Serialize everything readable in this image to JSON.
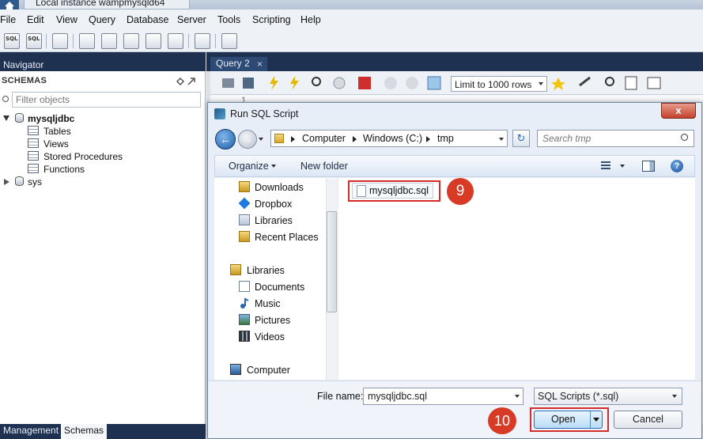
{
  "window": {
    "instance_tab": "Local instance wampmysqld64"
  },
  "menu": {
    "items": [
      "File",
      "Edit",
      "View",
      "Query",
      "Database",
      "Server",
      "Tools",
      "Scripting",
      "Help"
    ]
  },
  "navigator": {
    "title": "Navigator",
    "section": "SCHEMAS",
    "filter_placeholder": "Filter objects",
    "tree": {
      "db1": "mysqljdbc",
      "children": [
        "Tables",
        "Views",
        "Stored Procedures",
        "Functions"
      ],
      "db2": "sys"
    },
    "bottom_tabs": [
      "Management",
      "Schemas"
    ]
  },
  "editor": {
    "tab": "Query 2",
    "tab_close": "×",
    "limit": "Limit to 1000 rows",
    "line": "1"
  },
  "dialog": {
    "title": "Run SQL Script",
    "close": "x",
    "breadcrumb": [
      "Computer",
      "Windows (C:)",
      "tmp"
    ],
    "search_placeholder": "Search tmp",
    "organize": "Organize",
    "new_folder": "New folder",
    "help": "?",
    "nav_items": [
      {
        "label": "Downloads",
        "icon": "downloads-icon"
      },
      {
        "label": "Dropbox",
        "icon": "dropbox-icon"
      },
      {
        "label": "Libraries",
        "icon": "libraries-icon"
      },
      {
        "label": "Recent Places",
        "icon": "recent-places-icon"
      },
      {
        "label": "Libraries",
        "icon": "libraries-icon"
      },
      {
        "label": "Documents",
        "icon": "documents-icon"
      },
      {
        "label": "Music",
        "icon": "music-icon"
      },
      {
        "label": "Pictures",
        "icon": "pictures-icon"
      },
      {
        "label": "Videos",
        "icon": "videos-icon"
      },
      {
        "label": "Computer",
        "icon": "computer-icon"
      }
    ],
    "file": "mysqljdbc.sql",
    "filename_label": "File name:",
    "filename_value": "mysqljdbc.sql",
    "filetype": "SQL Scripts (*.sql)",
    "open": "Open",
    "cancel": "Cancel"
  },
  "annotations": {
    "step9": "9",
    "step10": "10"
  },
  "colors": {
    "highlight": "#d42b2b",
    "step_badge": "#d73b25",
    "nav_dark": "#1f3150"
  }
}
